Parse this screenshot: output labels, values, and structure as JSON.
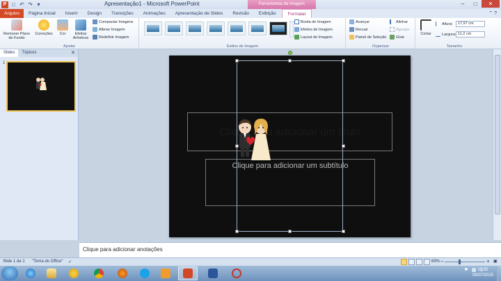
{
  "window": {
    "title": "Apresentação1 - Microsoft PowerPoint",
    "context_tab_title": "Ferramentas de Imagem",
    "controls": [
      "–",
      "□",
      "✕"
    ]
  },
  "tabs": [
    {
      "label": "Arquivo"
    },
    {
      "label": "Página Inicial"
    },
    {
      "label": "Inserir"
    },
    {
      "label": "Design"
    },
    {
      "label": "Transições"
    },
    {
      "label": "Animações"
    },
    {
      "label": "Apresentação de Slides"
    },
    {
      "label": "Revisão"
    },
    {
      "label": "Exibição"
    },
    {
      "label": "Formatar"
    }
  ],
  "ribbon": {
    "adjust": {
      "group_label": "Ajustar",
      "remove_bg": "Remover Plano de Fundo",
      "corrections": "Correções",
      "color": "Cor",
      "artistic": "Efeitos Artísticos",
      "compress": "Compactar Imagens",
      "change": "Alterar Imagem",
      "reset": "Redefinir Imagem"
    },
    "styles": {
      "group_label": "Estilos de Imagem",
      "border": "Borda de Imagem",
      "effects": "Efeitos de Imagem",
      "layout": "Layout de Imagem"
    },
    "arrange": {
      "group_label": "Organizar",
      "bring_forward": "Avançar",
      "send_backward": "Recuar",
      "selection_pane": "Painel de Seleção",
      "align": "Alinhar",
      "group": "Agrupar",
      "rotate": "Girar"
    },
    "size": {
      "group_label": "Tamanho",
      "crop": "Cortar",
      "height_label": "Altura:",
      "height_value": "17,97 cm",
      "width_label": "Largura:",
      "width_value": "11,2 cm"
    }
  },
  "left_pane": {
    "tab_slides": "Slides",
    "tab_outline": "Tópicos",
    "slide_number": "1"
  },
  "slide": {
    "title_placeholder": "Clique para adicionar um título",
    "subtitle_placeholder": "Clique para adicionar um subtítulo"
  },
  "notes": {
    "placeholder": "Clique para adicionar anotações"
  },
  "status": {
    "slide_of": "Slide 1 de 1",
    "theme": "\"Tema do Office\"",
    "zoom": "69%"
  },
  "clock": {
    "time": "15:55",
    "date": "09/07/2015"
  },
  "colors": {
    "file_tab": "#d44a25",
    "context_tab": "#d776ab",
    "slide_bg": "#0f0f0f"
  }
}
